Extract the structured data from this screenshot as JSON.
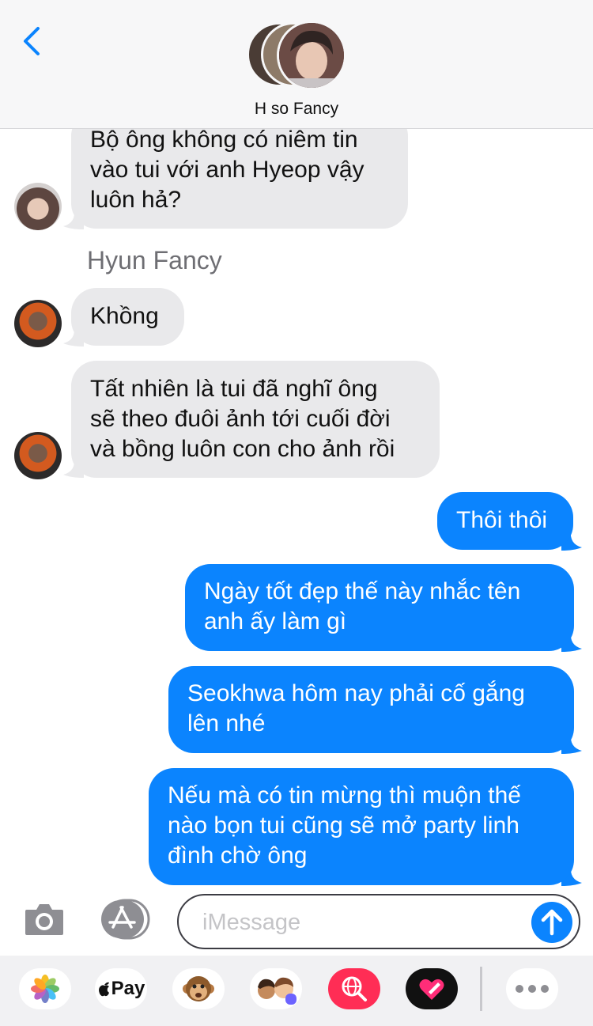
{
  "header": {
    "title": "H so Fancy",
    "back_icon": "chevron-left-icon",
    "accent": "#0b84fe"
  },
  "messages": {
    "m1": {
      "sender": "H so Fancy",
      "lines": [
        "Bộ ông không có niêm tin",
        "vào tui với anh Hyeop vậy",
        "luôn hả?"
      ]
    },
    "sender_name": "Hyun Fancy",
    "m2": {
      "lines": [
        "Khồng"
      ]
    },
    "m3": {
      "lines": [
        "Tất nhiên là tui đã nghĩ ông",
        "sẽ theo đuôi ảnh tới cuối đời",
        "và bồng luôn con cho ảnh rồi"
      ]
    },
    "m4": {
      "lines": [
        "Thôi thôi"
      ]
    },
    "m5": {
      "lines": [
        "Ngày tốt đẹp thế này nhắc tên",
        "anh ấy làm gì"
      ]
    },
    "m6": {
      "lines": [
        "Seokhwa hôm nay phải cố gắng",
        "lên nhé"
      ]
    },
    "m7": {
      "lines": [
        "Nếu mà có tin mừng thì muộn thế",
        "nào bọn tui cũng sẽ mở party linh",
        "đình chờ ông"
      ]
    }
  },
  "composer": {
    "placeholder": "iMessage",
    "value": ""
  },
  "app_drawer": {
    "items": [
      "photos-icon",
      "apple-pay-icon",
      "monkey-memoji-icon",
      "memoji-stickers-icon",
      "web-search-icon",
      "digital-touch-icon",
      "more-icon"
    ],
    "apple_pay_label": "Pay"
  },
  "colors": {
    "incoming_bubble": "#e9e9eb",
    "outgoing_bubble": "#0b84fe",
    "header_bg": "#f7f7f8"
  }
}
